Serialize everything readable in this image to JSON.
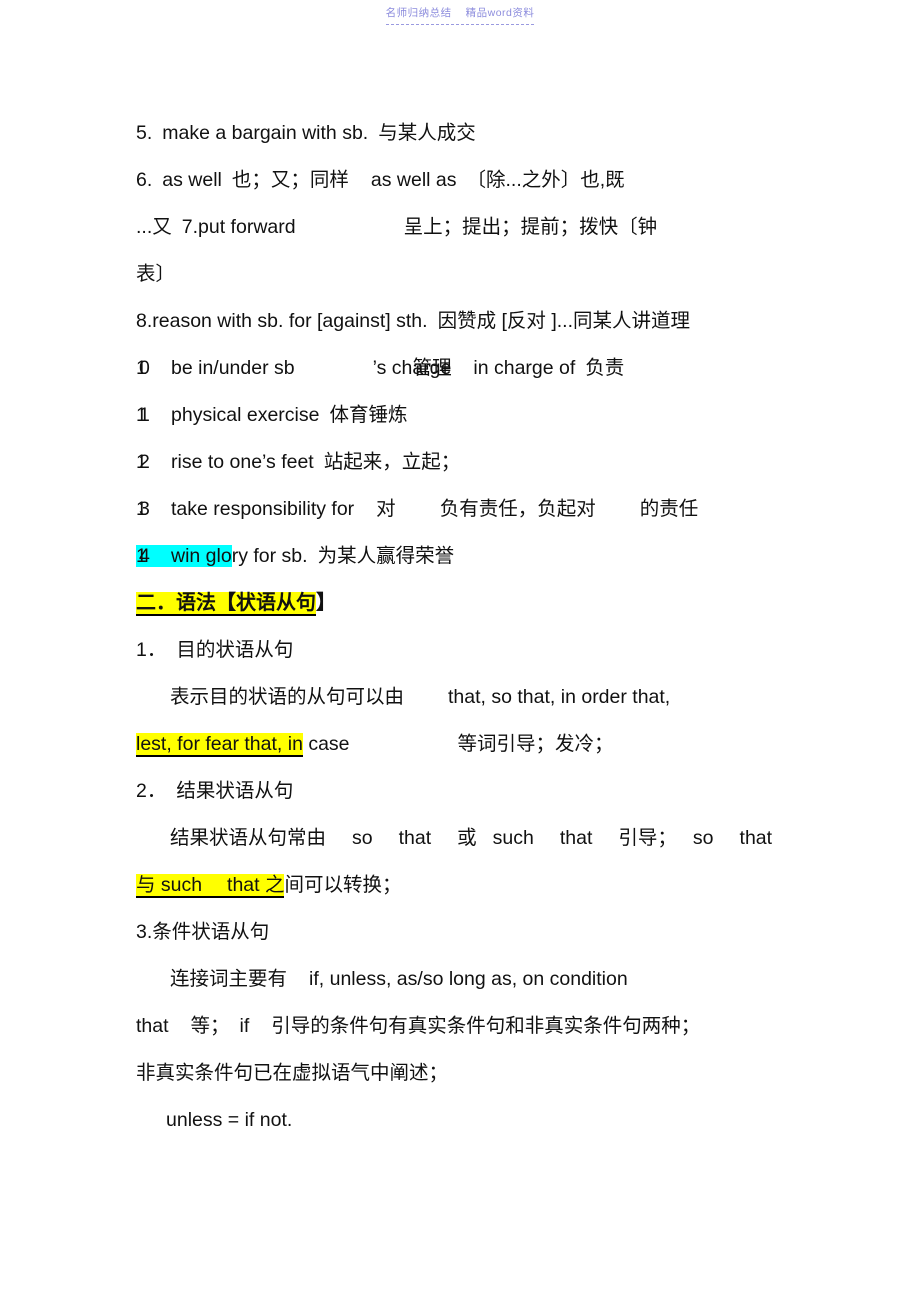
{
  "header": {
    "watermark_left": "名师归纳总结",
    "watermark_right": "精品word资料"
  },
  "vocab": {
    "items": [
      {
        "num": "5.",
        "english": "make a bargain with sb.",
        "chinese": "与某人成交"
      },
      {
        "num": "6.",
        "english": "as well",
        "chinese": "也；又；同样",
        "english2": "as well as",
        "chinese2": "〔除...之外〕也,既",
        "chinese3": "...又"
      },
      {
        "num": "7.",
        "english": "put forward",
        "chinese": "呈上；提出；提前；拨快〔钟",
        "chinese_cont": "表〕"
      },
      {
        "num": "8.",
        "english": "reason with sb. for [against] sth.",
        "chinese": "因赞成 [反对 ]...同某人讲道理"
      },
      {
        "num": "10",
        "english_a": "be in/under sb",
        "english_b": "’s charge",
        "overlap_gloss": "管理",
        "english_c": "in charge of",
        "chinese": "负责"
      },
      {
        "num": "11",
        "english": "physical exercise",
        "chinese": "体育锤炼"
      },
      {
        "num": "12",
        "english": "rise to one’s feet",
        "chinese": "站起来，立起；"
      },
      {
        "num": "13",
        "english": "take responsibility for",
        "chinese": "对",
        "chinese2": "负有责任，负起对",
        "chinese3": "的责任"
      },
      {
        "num": "14",
        "english_hl": "win glo",
        "english_rest": "ry for sb.",
        "chinese": "为某人赢得荣誉"
      }
    ]
  },
  "grammar": {
    "heading_hl": "二．语法【状语从句",
    "heading_rest": "】",
    "sections": [
      {
        "num": "1．",
        "title": "目的状语从句",
        "body_lead": "表示目的状语的从句可以由",
        "body_en": "that, so that, in order that,",
        "cont_hl": "lest, for fear that, in",
        "cont_rest": " case",
        "cont_tail": "等词引导；发冷；"
      },
      {
        "num": "2．",
        "title": "结果状语从句",
        "body_lead": "结果状语从句常由",
        "w1": "so",
        "w2": "that",
        "w3": "或",
        "w4": "such",
        "w5": "that",
        "w6": "引导；",
        "w7": "so",
        "w8": "that",
        "cont_hl": "与 such　 that 之",
        "cont_rest": "间可以转换；"
      },
      {
        "num": "3.",
        "title": "条件状语从句",
        "body_lead": "连接词主要有",
        "body_en": "if, unless, as/so long as, on condition",
        "line2_en": "that",
        "line2_a": "等；",
        "line2_b": "if",
        "line2_c": "引导的条件句有真实条件句和非真实条件句两种；",
        "line3": "非真实条件句已在虚拟语气中阐述；",
        "note": "unless = if not."
      }
    ]
  }
}
